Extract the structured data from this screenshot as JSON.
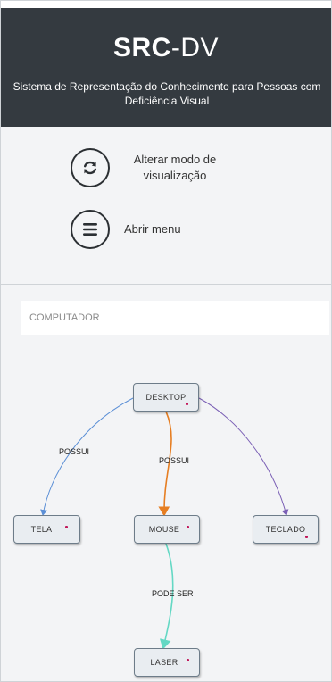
{
  "header": {
    "brand_bold": "SRC",
    "brand_light": "-DV",
    "subtitle": "Sistema de Representação do Conhecimento para Pessoas com Deficiência Visual"
  },
  "controls": {
    "toggle_view_label": "Alterar modo de visualização",
    "toggle_view_icon": "refresh-icon",
    "menu_label": "Abrir menu",
    "menu_icon": "hamburger-menu-icon"
  },
  "search": {
    "placeholder": "COMPUTADOR"
  },
  "graph": {
    "nodes": [
      {
        "id": "desktop",
        "label": "DESKTOP"
      },
      {
        "id": "tela",
        "label": "TELA"
      },
      {
        "id": "mouse",
        "label": "MOUSE"
      },
      {
        "id": "teclado",
        "label": "TECLADO"
      },
      {
        "id": "laser",
        "label": "LASER"
      }
    ],
    "edges": [
      {
        "from": "desktop",
        "to": "tela",
        "label": "POSSUI",
        "color": "#5b8fd6"
      },
      {
        "from": "desktop",
        "to": "mouse",
        "label": "POSSUI",
        "color": "#e67e22"
      },
      {
        "from": "desktop",
        "to": "teclado",
        "label": "",
        "color": "#7a5fb5"
      },
      {
        "from": "mouse",
        "to": "laser",
        "label": "PODE SER",
        "color": "#64d8c4"
      }
    ]
  },
  "colors": {
    "header_bg": "#343a40",
    "page_bg": "#f3f4f6",
    "node_marker": "#c2185b"
  }
}
